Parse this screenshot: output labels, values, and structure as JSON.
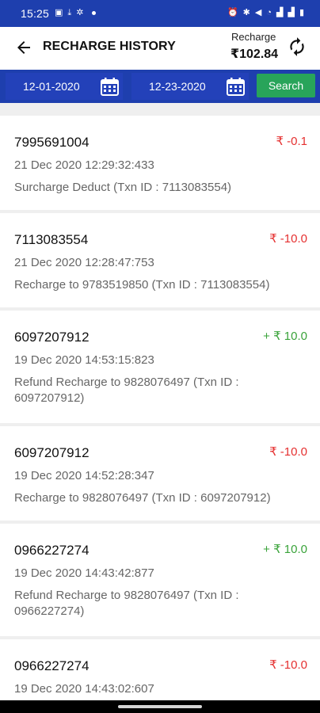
{
  "status": {
    "time": "15:25"
  },
  "header": {
    "title": "RECHARGE HISTORY",
    "balance_label": "Recharge",
    "balance_value": "₹102.84"
  },
  "filters": {
    "from_date": "12-01-2020",
    "to_date": "12-23-2020",
    "search_label": "Search"
  },
  "colors": {
    "primary_blue": "#1e3fae",
    "search_green": "#28a45a",
    "debit_red": "#e53030",
    "credit_green": "#3aa33a"
  },
  "transactions": [
    {
      "id": "7995691004",
      "amount": "₹ -0.1",
      "type": "debit",
      "datetime": "21 Dec 2020 12:29:32:433",
      "description": "Surcharge Deduct (Txn ID : 7113083554)"
    },
    {
      "id": "7113083554",
      "amount": "₹ -10.0",
      "type": "debit",
      "datetime": "21 Dec 2020 12:28:47:753",
      "description": "Recharge to 9783519850 (Txn ID : 7113083554)"
    },
    {
      "id": "6097207912",
      "amount": "+ ₹ 10.0",
      "type": "credit",
      "datetime": "19 Dec 2020 14:53:15:823",
      "description": "Refund Recharge to 9828076497 (Txn ID : 6097207912)"
    },
    {
      "id": "6097207912",
      "amount": "₹ -10.0",
      "type": "debit",
      "datetime": "19 Dec 2020 14:52:28:347",
      "description": "Recharge to 9828076497 (Txn ID : 6097207912)"
    },
    {
      "id": "0966227274",
      "amount": "+ ₹ 10.0",
      "type": "credit",
      "datetime": "19 Dec 2020 14:43:42:877",
      "description": "Refund Recharge to 9828076497 (Txn ID : 0966227274)"
    },
    {
      "id": "0966227274",
      "amount": "₹ -10.0",
      "type": "debit",
      "datetime": "19 Dec 2020 14:43:02:607",
      "description": ""
    }
  ]
}
